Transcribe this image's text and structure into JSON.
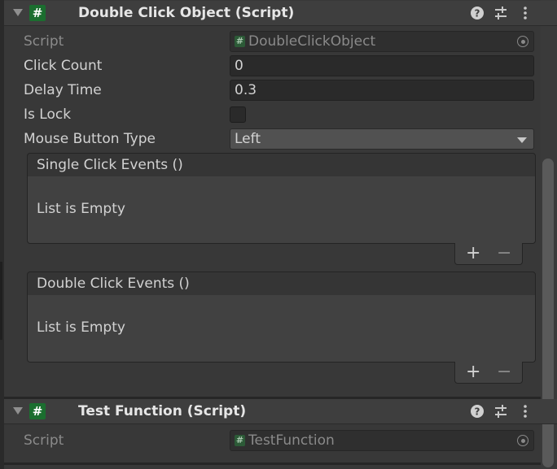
{
  "components": [
    {
      "title": "Double Click Object (Script)",
      "script_label": "Script",
      "script_value": "DoubleClickObject",
      "fields": [
        {
          "label": "Click Count",
          "value": "0"
        },
        {
          "label": "Delay Time",
          "value": "0.3"
        },
        {
          "label": "Is Lock"
        },
        {
          "label": "Mouse Button Type",
          "value": "Left"
        }
      ],
      "events": [
        {
          "title": "Single Click Events ()",
          "empty_text": "List is Empty",
          "add": "+",
          "remove": "−"
        },
        {
          "title": "Double Click Events ()",
          "empty_text": "List is Empty",
          "add": "+",
          "remove": "−"
        }
      ]
    },
    {
      "title": "Test Function (Script)",
      "script_label": "Script",
      "script_value": "TestFunction"
    }
  ],
  "icons": {
    "script": "#",
    "header": [
      "help-icon",
      "preset-icon",
      "kebab-menu-icon"
    ]
  },
  "colors": {
    "background": "#383838",
    "header": "#3e3e3e",
    "field": "#2a2a2a",
    "script_icon": "#1b6e2f"
  }
}
